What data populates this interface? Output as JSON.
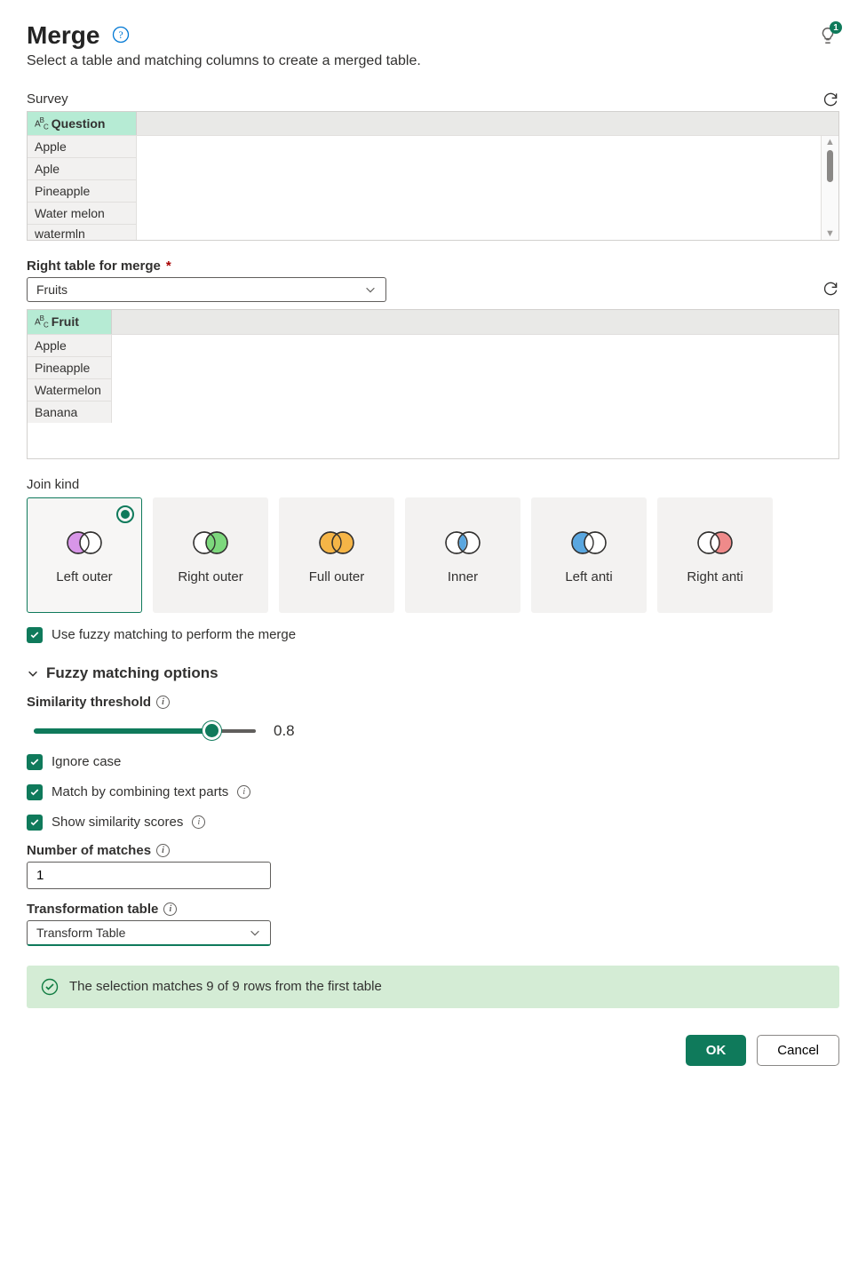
{
  "header": {
    "title": "Merge",
    "subtitle": "Select a table and matching columns to create a merged table.",
    "idea_count": "1"
  },
  "left_table": {
    "label": "Survey",
    "column": "Question",
    "rows": [
      "Apple",
      "Aple",
      "Pineapple",
      "Water melon",
      "watermln"
    ]
  },
  "right_table": {
    "label": "Right table for merge",
    "selected": "Fruits",
    "column": "Fruit",
    "rows": [
      "Apple",
      "Pineapple",
      "Watermelon",
      "Banana"
    ]
  },
  "join": {
    "label": "Join kind",
    "options": [
      "Left outer",
      "Right outer",
      "Full outer",
      "Inner",
      "Left anti",
      "Right anti"
    ],
    "selected": "Left outer"
  },
  "fuzzy": {
    "checkbox_label": "Use fuzzy matching to perform the merge",
    "section_label": "Fuzzy matching options",
    "threshold_label": "Similarity threshold",
    "threshold_value": "0.8",
    "ignore_case_label": "Ignore case",
    "combine_label": "Match by combining text parts",
    "scores_label": "Show similarity scores",
    "num_matches_label": "Number of matches",
    "num_matches_value": "1",
    "transform_label": "Transformation table",
    "transform_value": "Transform Table"
  },
  "status": "The selection matches 9 of 9 rows from the first table",
  "footer": {
    "ok": "OK",
    "cancel": "Cancel"
  }
}
